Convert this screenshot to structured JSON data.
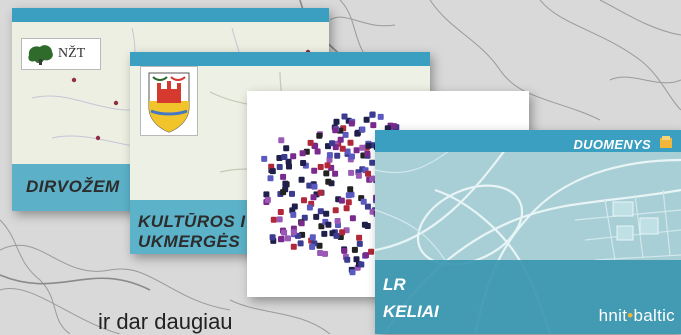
{
  "card_soil": {
    "title": "DIRVOŽEM",
    "logo_text": "NŽT"
  },
  "card_culture": {
    "title_line1": "KULTŪROS I",
    "title_line2": "UKMERGĖS"
  },
  "card_roads": {
    "data_label": "DUOMENYS",
    "title_line1": "LR",
    "title_line2": "KELIAI",
    "brand_left": "hnit",
    "brand_dot": "•",
    "brand_right": "baltic"
  },
  "caption": "ir dar daugiau",
  "colors": {
    "strip": "#3a9fc0",
    "brand_accent": "#f2b63a",
    "background": "#d9d9d9"
  },
  "icons": [
    "tree-logo-icon",
    "coat-of-arms-icon",
    "document-icon"
  ]
}
